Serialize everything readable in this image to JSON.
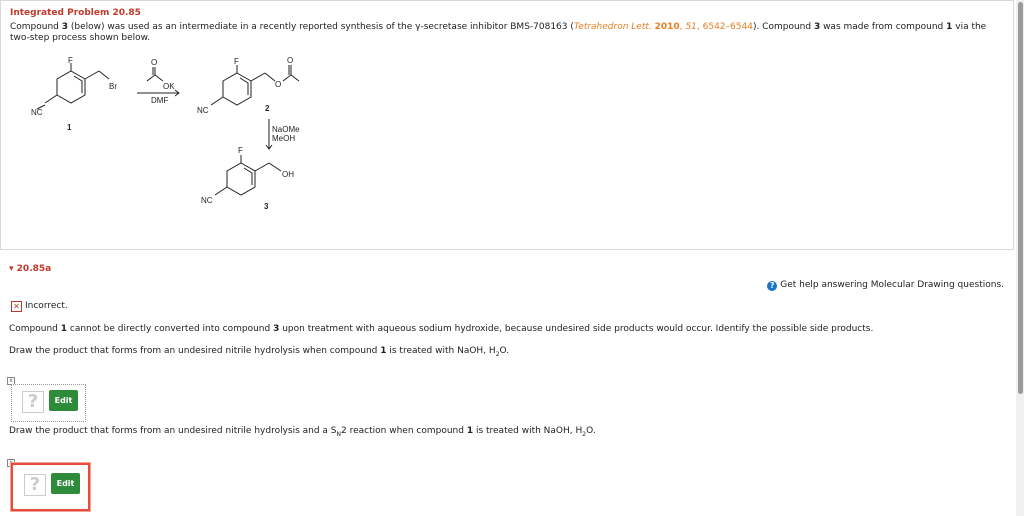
{
  "problem": {
    "title": "Integrated Problem 20.85",
    "intro_prefix": "Compound ",
    "compound3": "3",
    "intro_mid": " (below) was used as an intermediate in a recently reported synthesis of the γ-secretase inhibitor BMS-708163 (",
    "ref_journal": "Tetrahedron Lett.",
    "ref_year": "2010",
    "ref_vol": "51",
    "ref_pages": "6542–6544",
    "intro_mid2": "). Compound ",
    "intro_mid3": " was made from compound ",
    "compound1": "1",
    "intro_end": " via the two-step process shown below."
  },
  "scheme": {
    "labels": {
      "F": "F",
      "NC": "NC",
      "Br": "Br",
      "O": "O",
      "OK": "OK",
      "OH": "OH"
    },
    "reagent1": "DMF",
    "reagent2a": "NaOMe",
    "reagent2b": "MeOH",
    "num1": "1",
    "num2": "2",
    "num3": "3"
  },
  "part": {
    "label": "20.85a",
    "help_text": "Get help answering Molecular Drawing questions.",
    "status": "Incorrect.",
    "explain_prefix": "Compound ",
    "explain_c1": "1",
    "explain_mid": " cannot be directly converted into compound ",
    "explain_c3": "3",
    "explain_end": " upon treatment with aqueous sodium hydroxide, because undesired side products would occur. Identify the possible side products.",
    "q1_prefix": "Draw the product that forms from an undesired nitrile hydrolysis when compound ",
    "q1_c1": "1",
    "q1_end": " is treated with NaOH, H",
    "q1_sub": "2",
    "q1_tail": "O.",
    "q2_prefix": "Draw the product that forms from an undesired nitrile hydrolysis and a S",
    "q2_sn_sub": "N",
    "q2_mid": "2 reaction when compound ",
    "q2_c1": "1",
    "q2_end": " is treated with NaOH, H",
    "q2_sub": "2",
    "q2_tail": "O.",
    "question_mark": "?",
    "edit_label": "Edit",
    "close_glyph": "x"
  },
  "colors": {
    "accent_red": "#c0392b",
    "link_orange": "#e67e22",
    "edit_green": "#2e8b3a",
    "help_blue": "#1a73c9",
    "error_border": "#e74c3c"
  }
}
